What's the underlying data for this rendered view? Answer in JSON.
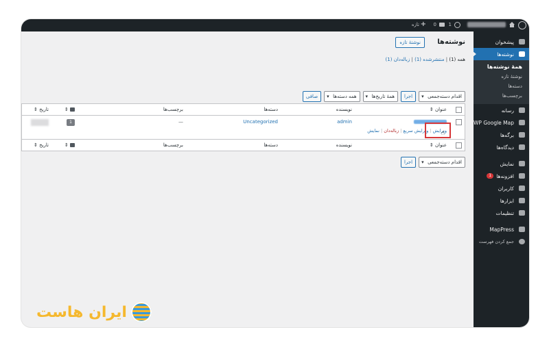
{
  "adminbar": {
    "new_label": "تازه",
    "comments_count": "0",
    "updates_count": "1"
  },
  "sidebar": {
    "items": [
      {
        "label": "پیشخوان",
        "icon": "dashboard-icon"
      },
      {
        "label": "نوشته‌ها",
        "icon": "pin-icon"
      }
    ],
    "submenu": [
      {
        "label": "همهٔ نوشته‌ها"
      },
      {
        "label": "نوشتهٔ تازه"
      },
      {
        "label": "دسته‌ها"
      },
      {
        "label": "برچسب‌ها"
      }
    ],
    "items2": [
      {
        "label": "رسانه",
        "icon": "media-icon"
      },
      {
        "label": "WP Google Map",
        "icon": "map-pin-icon"
      },
      {
        "label": "برگه‌ها",
        "icon": "pages-icon"
      },
      {
        "label": "دیدگاه‌ها",
        "icon": "comments-icon"
      },
      {
        "label": "نمایش",
        "icon": "appearance-icon"
      },
      {
        "label": "افزونه‌ها",
        "icon": "plugins-icon",
        "badge": "1"
      },
      {
        "label": "کاربران",
        "icon": "users-icon"
      },
      {
        "label": "ابزارها",
        "icon": "tools-icon"
      },
      {
        "label": "تنظیمات",
        "icon": "settings-icon"
      },
      {
        "label": "MapPress",
        "icon": "mappress-icon"
      },
      {
        "label": "جمع کردن فهرست",
        "icon": "collapse-icon"
      }
    ]
  },
  "page": {
    "title": "نوشته‌ها",
    "add_new": "نوشتهٔ تازه",
    "filters": {
      "all": "همه (1)",
      "sep1": " | ",
      "published": "منتشرشده (1)",
      "sep2": " | ",
      "trash": "زباله‌دان (1)"
    }
  },
  "tablenav": {
    "bulk_action": "اقدام دسته‌جمعی",
    "apply": "اجرا",
    "all_dates": "همهٔ تاریخ‌ها",
    "all_categories": "همه دسته‌ها",
    "filter": "صافی"
  },
  "table": {
    "headers": {
      "title": "عنوان",
      "author": "نویسنده",
      "categories": "دسته‌ها",
      "tags": "برچسب‌ها",
      "date": "تاریخ"
    },
    "row": {
      "author": "admin",
      "category": "Uncategorized",
      "tags": "—",
      "comments": "1",
      "actions": {
        "edit": "ویرایش",
        "quick_edit": "ویرایش سریع",
        "trash": "زباله‌دان",
        "view": "نمایش",
        "sep": " | "
      }
    }
  },
  "watermark": {
    "text": "ایران هاست"
  }
}
